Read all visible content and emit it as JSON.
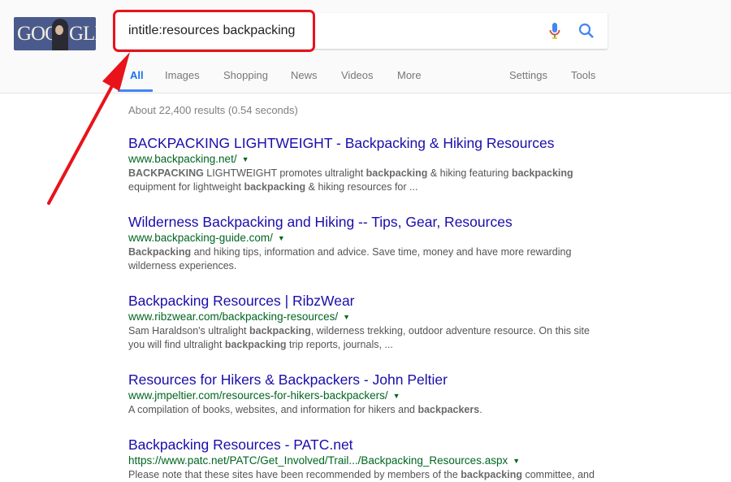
{
  "logo": {
    "left": "GOO",
    "right": "GLE"
  },
  "search": {
    "query": "intitle:resources backpacking"
  },
  "tabs": [
    {
      "label": "All",
      "active": true
    },
    {
      "label": "Images"
    },
    {
      "label": "Shopping"
    },
    {
      "label": "News"
    },
    {
      "label": "Videos"
    },
    {
      "label": "More"
    }
  ],
  "tools": {
    "settings": "Settings",
    "tools": "Tools"
  },
  "stats": "About 22,400 results (0.54 seconds)",
  "colors": {
    "annotation": "#e8131a",
    "link": "#1a0dab",
    "url": "#006621",
    "accent": "#4285f4"
  },
  "results": [
    {
      "title": "BACKPACKING LIGHTWEIGHT - Backpacking & Hiking Resources",
      "url": "www.backpacking.net/",
      "snippet": [
        [
          "BACKPACKING",
          1
        ],
        [
          " LIGHTWEIGHT promotes ultralight ",
          0
        ],
        [
          "backpacking",
          1
        ],
        [
          " & hiking featuring ",
          0
        ],
        [
          "backpacking",
          1
        ],
        [
          " equipment for lightweight ",
          0
        ],
        [
          "backpacking",
          1
        ],
        [
          " & hiking resources for ...",
          0
        ]
      ]
    },
    {
      "title": "Wilderness Backpacking and Hiking -- Tips, Gear, Resources",
      "url": "www.backpacking-guide.com/",
      "snippet": [
        [
          "Backpacking",
          1
        ],
        [
          " and hiking tips, information and advice. Save time, money and have more rewarding wilderness experiences.",
          0
        ]
      ]
    },
    {
      "title": "Backpacking Resources | RibzWear",
      "url": "www.ribzwear.com/backpacking-resources/",
      "snippet": [
        [
          "Sam Haraldson's ultralight ",
          0
        ],
        [
          "backpacking",
          1
        ],
        [
          ", wilderness trekking, outdoor adventure resource. On this site you will find ultralight ",
          0
        ],
        [
          "backpacking",
          1
        ],
        [
          " trip reports, journals, ...",
          0
        ]
      ]
    },
    {
      "title": "Resources for Hikers & Backpackers - John Peltier",
      "url": "www.jmpeltier.com/resources-for-hikers-backpackers/",
      "snippet": [
        [
          "A compilation of books, websites, and information for hikers and ",
          0
        ],
        [
          "backpackers",
          1
        ],
        [
          ".",
          0
        ]
      ]
    },
    {
      "title": "Backpacking Resources - PATC.net",
      "url": "https://www.patc.net/PATC/Get_Involved/Trail.../Backpacking_Resources.aspx",
      "snippet": [
        [
          "Please note that these sites have been recommended by members of the ",
          0
        ],
        [
          "backpacking",
          1
        ],
        [
          " committee, and",
          0
        ]
      ]
    }
  ]
}
